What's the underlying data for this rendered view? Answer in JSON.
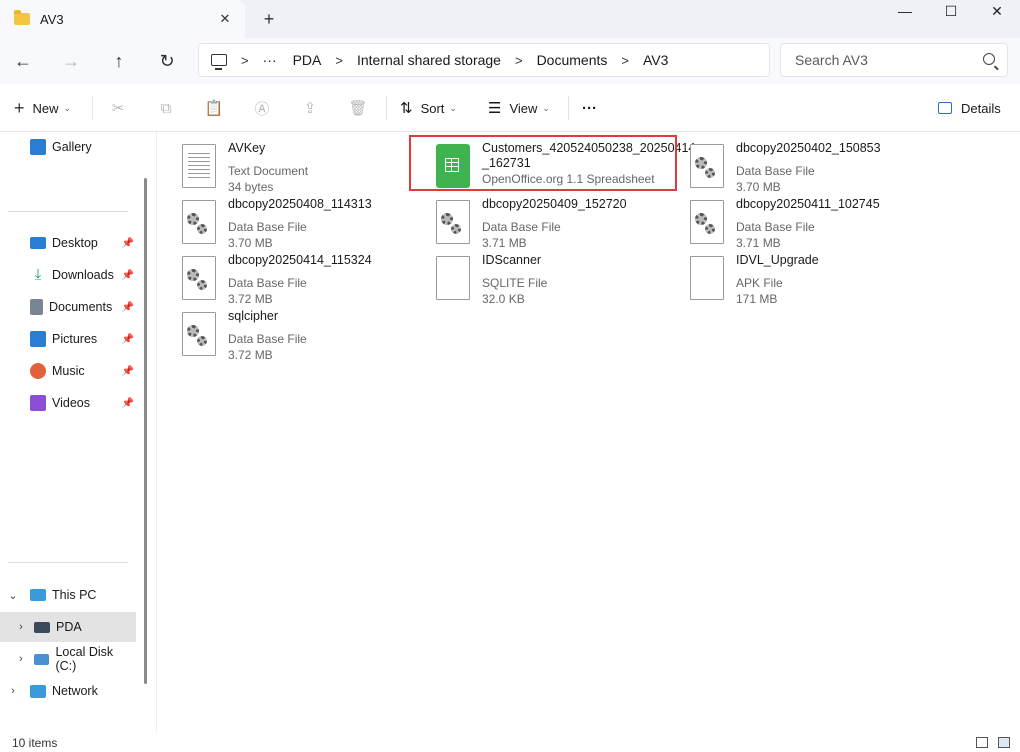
{
  "window": {
    "tab_title": "AV3",
    "tab_close": "✕",
    "new_tab": "+",
    "minimize": "—",
    "maximize": "☐",
    "close": "✕"
  },
  "nav": {
    "back": "←",
    "forward": "→",
    "up": "↑",
    "refresh": "↻"
  },
  "address": {
    "ellipsis": "···",
    "sep": ">",
    "crumbs": [
      "PDA",
      "Internal shared storage",
      "Documents",
      "AV3"
    ]
  },
  "search": {
    "placeholder": "Search AV3"
  },
  "toolbar": {
    "new_label": "New",
    "sort_label": "Sort",
    "view_label": "View",
    "more_label": "···",
    "details_label": "Details"
  },
  "sidebar": {
    "gallery": "Gallery",
    "quick_access": [
      {
        "label": "Desktop",
        "color": "#2b7cd3"
      },
      {
        "label": "Downloads",
        "color": "#21a366"
      },
      {
        "label": "Documents",
        "color": "#7a8594"
      },
      {
        "label": "Pictures",
        "color": "#2b7cd3"
      },
      {
        "label": "Music",
        "color": "#e0623d"
      },
      {
        "label": "Videos",
        "color": "#8a4fd6"
      }
    ],
    "pin": "📌",
    "this_pc": "This PC",
    "pda": "PDA",
    "local_disk": "Local Disk (C:)",
    "network": "Network"
  },
  "files": [
    {
      "name": "AVKey",
      "type": "Text Document",
      "size": "34 bytes",
      "icon": "text-document-icon"
    },
    {
      "name": "Customers_420524050238_20250414",
      "name2": "_162731",
      "type": "OpenOffice.org 1.1 Spreadsheet",
      "icon": "spreadsheet-icon"
    },
    {
      "name": "dbcopy20250402_150853",
      "type": "Data Base File",
      "size": "3.70 MB",
      "icon": "database-file-icon"
    },
    {
      "name": "dbcopy20250408_114313",
      "type": "Data Base File",
      "size": "3.70 MB",
      "icon": "database-file-icon"
    },
    {
      "name": "dbcopy20250409_152720",
      "type": "Data Base File",
      "size": "3.71 MB",
      "icon": "database-file-icon"
    },
    {
      "name": "dbcopy20250411_102745",
      "type": "Data Base File",
      "size": "3.71 MB",
      "icon": "database-file-icon"
    },
    {
      "name": "dbcopy20250414_115324",
      "type": "Data Base File",
      "size": "3.72 MB",
      "icon": "database-file-icon"
    },
    {
      "name": "IDScanner",
      "type": "SQLITE File",
      "size": "32.0 KB",
      "icon": "blank-file-icon"
    },
    {
      "name": "IDVL_Upgrade",
      "type": "APK File",
      "size": "171 MB",
      "icon": "blank-file-icon"
    },
    {
      "name": "sqlcipher",
      "type": "Data Base File",
      "size": "3.72 MB",
      "icon": "database-file-icon"
    }
  ],
  "status": {
    "count": "10 items"
  },
  "colors": {
    "highlight": "#e23a3a",
    "spreadsheet": "#3fb34f"
  }
}
